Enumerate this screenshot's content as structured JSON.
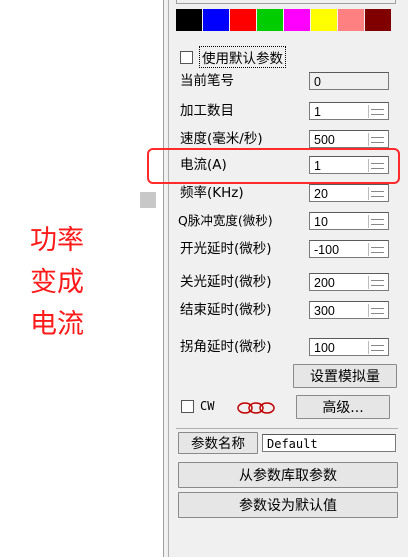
{
  "colors": {
    "swatches": [
      "#000000",
      "#0000ff",
      "#ff0000",
      "#00cc00",
      "#ff00ff",
      "#ffff00",
      "#ff8080",
      "#800000"
    ],
    "highlight": "#ff2a2a",
    "note": "#ff1a1a"
  },
  "use_default_params_label": "使用默认参数",
  "fields": [
    {
      "label": "当前笔号",
      "value": "0",
      "spinner": false
    },
    {
      "label": "加工数目",
      "value": "1",
      "spinner": true
    },
    {
      "label": "速度(毫米/秒)",
      "value": "500",
      "spinner": true
    },
    {
      "label": "电流(A)",
      "value": "1",
      "spinner": true
    },
    {
      "label": "频率(KHz)",
      "value": "20",
      "spinner": true
    },
    {
      "label": "Q脉冲宽度(微秒)",
      "value": "10",
      "spinner": true
    },
    {
      "label": "开光延时(微秒)",
      "value": "-100",
      "spinner": true
    },
    {
      "label": "关光延时(微秒)",
      "value": "200",
      "spinner": true
    },
    {
      "label": "结束延时(微秒)",
      "value": "300",
      "spinner": true
    },
    {
      "label": "拐角延时(微秒)",
      "value": "100",
      "spinner": true
    }
  ],
  "buttons": {
    "set_analog": "设置模拟量",
    "advanced": "高级...",
    "load_from_library": "从参数库取参数",
    "set_as_default": "参数设为默认值"
  },
  "cw_label": "CW",
  "param_name_label": "参数名称",
  "param_name_value": "Default",
  "annotation": [
    "功率",
    "变成",
    "电流"
  ]
}
